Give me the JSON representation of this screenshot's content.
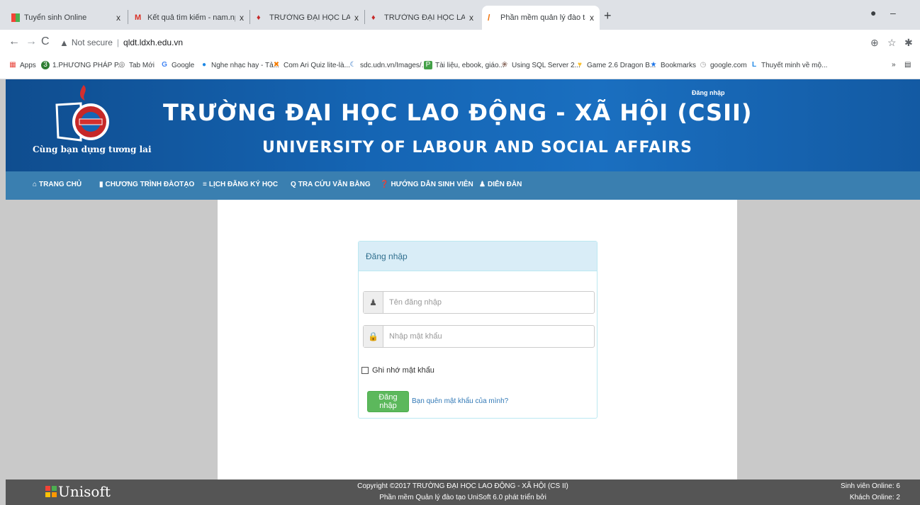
{
  "browser": {
    "tabs": [
      {
        "title": "Tuyển sinh Online",
        "close": "x"
      },
      {
        "title": "Kết quả tìm kiếm - nam.np@ldxh",
        "close": "x"
      },
      {
        "title": "TRƯỜNG ĐẠI HỌC LAO ĐỘNG X",
        "close": "x"
      },
      {
        "title": "TRƯỜNG ĐẠI HỌC LAO ĐỘNG X",
        "close": "x"
      },
      {
        "title": "Phần mềm quản lý đào tạo tín ch",
        "close": "x"
      }
    ],
    "new_tab": "+",
    "not_secure": "Not secure",
    "url": "qldt.ldxh.edu.vn",
    "bookmarks": [
      {
        "label": "Apps",
        "icon": "apps-grid-icon",
        "color": "#e8453c"
      },
      {
        "label": "1.PHƯƠNG PHÁP P...",
        "icon": "circle-3-icon",
        "color": "#2e7d32"
      },
      {
        "label": "Tab Mới",
        "icon": "chrome-icon",
        "color": "#666666"
      },
      {
        "label": "Google",
        "icon": "google-icon",
        "color": "#4285f4"
      },
      {
        "label": "Nghe nhạc hay - Tả...",
        "icon": "music-icon",
        "color": "#1e88e5"
      },
      {
        "label": "Com Ari Quiz lite-là...",
        "icon": "joomla-icon",
        "color": "#f57c00"
      },
      {
        "label": "sdc.udn.vn/Images/...",
        "icon": "moon-icon",
        "color": "#1565c0"
      },
      {
        "label": "Tài liệu, ebook, giáo...",
        "icon": "doc-icon",
        "color": "#43a047"
      },
      {
        "label": "Using SQL Server 2...",
        "icon": "sql-icon",
        "color": "#8d6e63"
      },
      {
        "label": "Game 2.6 Dragon B...",
        "icon": "game-icon",
        "color": "#fbc02d"
      },
      {
        "label": "Bookmarks",
        "icon": "star-icon",
        "color": "#1a73e8"
      },
      {
        "label": "google.com",
        "icon": "globe-icon",
        "color": "#9e9e9e"
      },
      {
        "label": "Thuyết minh về mộ...",
        "icon": "l-icon",
        "color": "#1e88e5"
      }
    ],
    "more_bookmarks": "»"
  },
  "header": {
    "title_vi": "TRƯỜNG ĐẠI HỌC LAO ĐỘNG - XÃ HỘI (CSII)",
    "title_en": "UNIVERSITY OF LABOUR AND SOCIAL AFFAIRS",
    "slogan": "Cùng bạn dựng tương lai",
    "top_login": "Đăng nhập"
  },
  "nav": {
    "items": [
      {
        "label": "TRANG CHỦ",
        "icon": "home-icon"
      },
      {
        "label": "CHƯƠNG TRÌNH ĐÀOTẠO",
        "icon": "book-icon"
      },
      {
        "label": "LỊCH ĐĂNG KÝ HỌC",
        "icon": "list-icon"
      },
      {
        "label": "TRA CỨU VĂN BẰNG",
        "icon": "search-icon"
      },
      {
        "label": "HƯỚNG DẪN SINH VIÊN",
        "icon": "question-icon"
      },
      {
        "label": "DIỄN ĐÀN",
        "icon": "user-icon"
      }
    ]
  },
  "login": {
    "title": "Đăng nhập",
    "username_placeholder": "Tên đăng nhập",
    "username_value": "",
    "password_placeholder": "Nhập mật khẩu",
    "password_value": "",
    "remember_label": "Ghi nhớ mật khẩu",
    "submit_label": "Đăng nhập",
    "forgot_label": "Bạn quên mật khẩu của mình?"
  },
  "footer": {
    "brand": "Unisoft",
    "copyright": "Copyright ©2017 TRƯỜNG ĐẠI HỌC LAO ĐỘNG - XÃ HỘI (CS II)",
    "powered_prefix": "Phần mềm Quản lý đào tạo UniSoft 6.0 phát triển bởi",
    "students_online": "Sinh viên Online: 6",
    "guests_online": "Khách Online: 2"
  },
  "colors": {
    "banner": "#1565b4",
    "nav": "#3a7fb0",
    "panel_header": "#d9edf7",
    "button": "#5cb85c",
    "footer": "#555555"
  }
}
